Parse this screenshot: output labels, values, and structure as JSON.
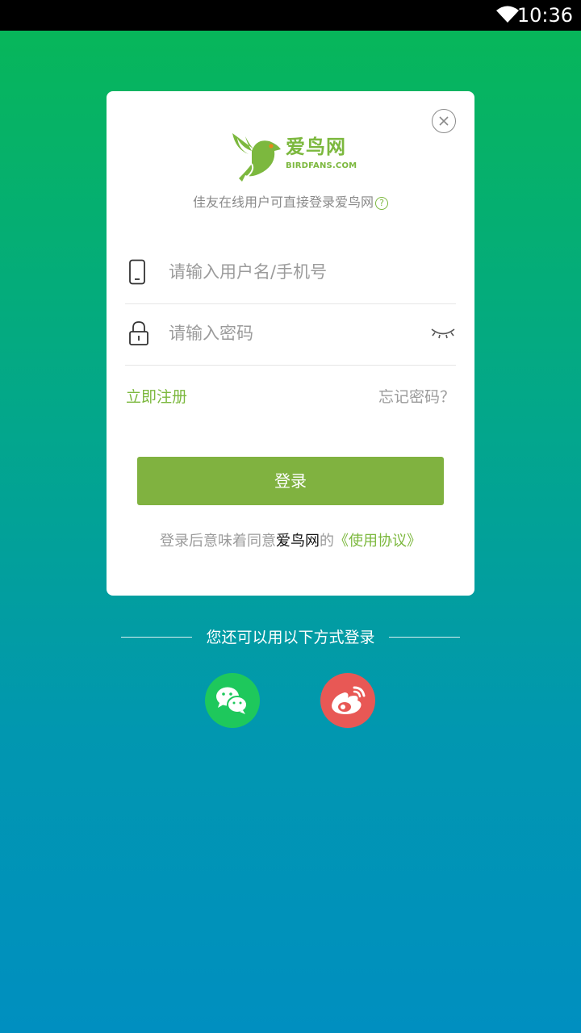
{
  "status_bar": {
    "time": "10:36",
    "icons": [
      "wifi-icon"
    ]
  },
  "logo": {
    "name": "爱鸟网",
    "domain": "BIRDFANS.COM"
  },
  "tagline": "佳友在线用户可直接登录爱鸟网",
  "help_icon_glyph": "?",
  "username": {
    "placeholder": "请输入用户名/手机号",
    "value": ""
  },
  "password": {
    "placeholder": "请输入密码",
    "value": ""
  },
  "links": {
    "register": "立即注册",
    "forgot": "忘记密码？"
  },
  "login_button": "登录",
  "agreement": {
    "prefix": "登录后意味着同意",
    "brand": "爱鸟网",
    "middle": "的",
    "link": "《使用协议》"
  },
  "alt_login": {
    "label": "您还可以用以下方式登录",
    "options": [
      "wechat-icon",
      "weibo-icon"
    ]
  },
  "colors": {
    "accent": "#7cb83e",
    "button": "#80b240",
    "gradient_top": "#07b65a",
    "gradient_bottom": "#008fc0",
    "wechat": "#1ec85c",
    "weibo": "#e85855"
  }
}
